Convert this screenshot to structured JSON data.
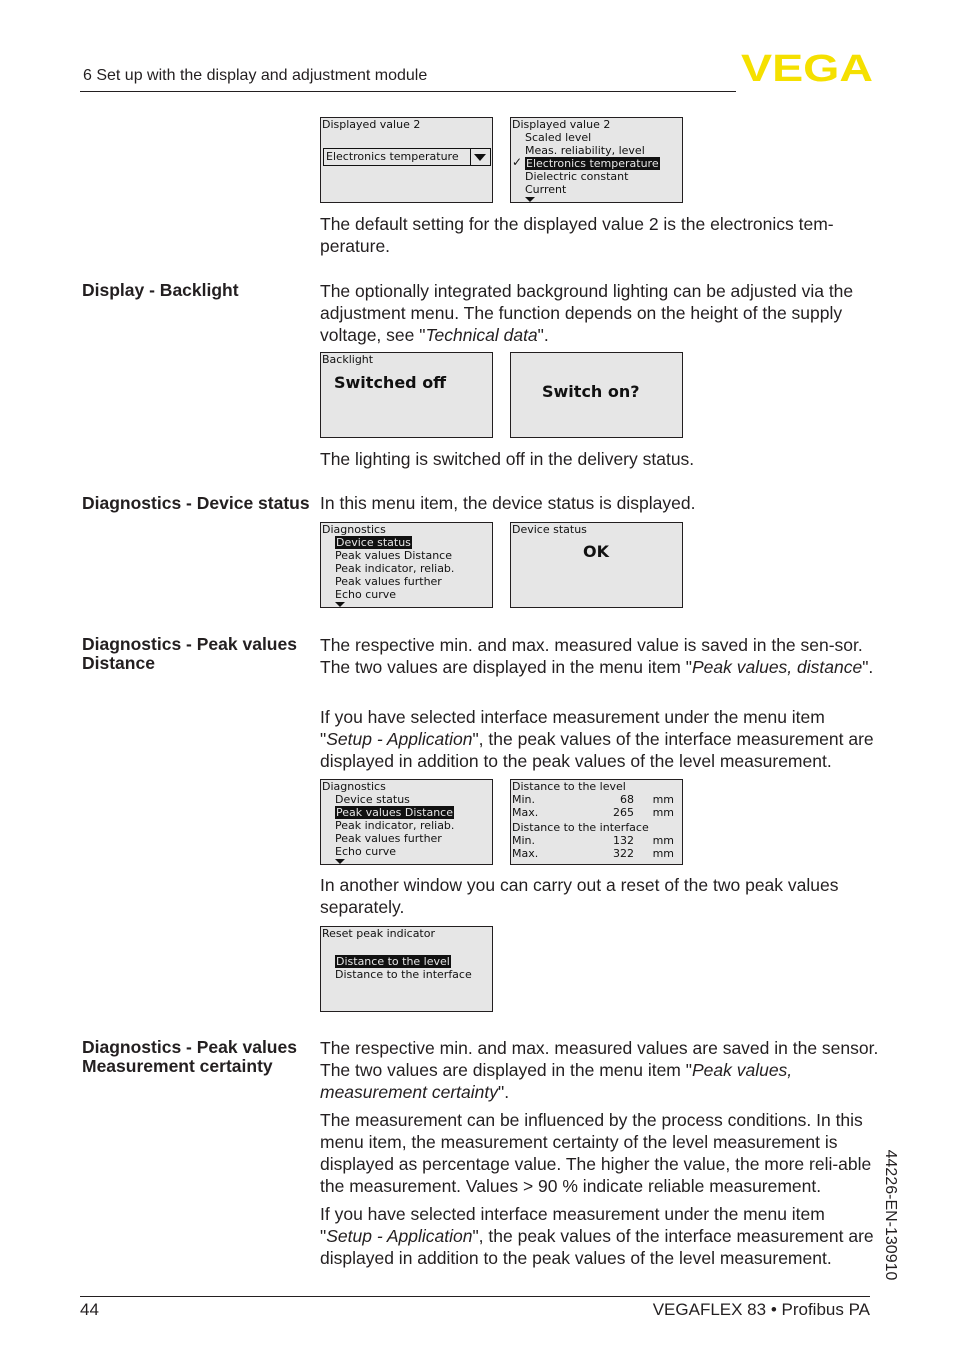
{
  "header": {
    "chapter": "6 Set up with the display and adjustment module",
    "logo_text": "VEGA",
    "logo_color": "#f5e000"
  },
  "footer": {
    "page_number": "44",
    "product": "VEGAFLEX 83 • Profibus PA",
    "doc_code": "44226-EN-130910"
  },
  "displayed_value": {
    "screen1": {
      "title": "Displayed value 2",
      "selected": "Electronics temperature"
    },
    "screen2": {
      "title": "Displayed value 2",
      "options": [
        "Scaled level",
        "Meas. reliability, level",
        "Electronics temperature",
        "Dielectric constant",
        "Current"
      ],
      "selected_index": 2
    },
    "text": "The default setting for the displayed value 2 is the electronics tem-perature."
  },
  "backlight": {
    "label": "Display - Backlight",
    "text_pre": "The optionally integrated background lighting can be adjusted via the adjustment menu. The function depends on the height of the supply voltage, see \"",
    "text_em": "Technical data",
    "text_post": "\".",
    "screen1": {
      "title": "Backlight",
      "value": "Switched off"
    },
    "screen2": {
      "value": "Switch on?"
    },
    "note": "The lighting is switched off in the delivery status."
  },
  "device_status": {
    "label": "Diagnostics - Device status",
    "text": "In this menu item, the device status is displayed.",
    "menu": {
      "title": "Diagnostics",
      "items": [
        "Device status",
        "Peak values Distance",
        "Peak indicator, reliab.",
        "Peak values further",
        "Echo curve"
      ],
      "selected_index": 0
    },
    "screen2": {
      "title": "Device status",
      "value": "OK"
    }
  },
  "peak_distance": {
    "label": "Diagnostics - Peak values Distance",
    "p1_pre": "The respective min. and max. measured value is saved in the sen-sor. The two values are displayed in the menu item \"",
    "p1_em": "Peak values, distance",
    "p1_post": "\".",
    "p2_pre": "If you have selected interface measurement under the menu item \"",
    "p2_em": "Setup - Application",
    "p2_post": "\", the peak values of the interface measurement are displayed in addition to the peak values of the level measurement.",
    "menu": {
      "title": "Diagnostics",
      "items": [
        "Device status",
        "Peak values Distance",
        "Peak indicator, reliab.",
        "Peak values further",
        "Echo curve"
      ],
      "selected_index": 1
    },
    "values": {
      "level_title": "Distance to the level",
      "level_min_label": "Min.",
      "level_min": "68",
      "level_min_unit": "mm",
      "level_max_label": "Max.",
      "level_max": "265",
      "level_max_unit": "mm",
      "interface_title": "Distance to the interface",
      "interface_min_label": "Min.",
      "interface_min": "132",
      "interface_min_unit": "mm",
      "interface_max_label": "Max.",
      "interface_max": "322",
      "interface_max_unit": "mm"
    },
    "reset_text": "In another window you can carry out a reset of the two peak values separately.",
    "reset_screen": {
      "title": "Reset peak indicator",
      "items": [
        "Distance to the level",
        "Distance to the interface"
      ],
      "selected_index": 0
    }
  },
  "peak_certainty": {
    "label": "Diagnostics - Peak values Measurement certainty",
    "p1_pre": "The respective min. and max. measured values are saved in the sensor. The two values are displayed in the menu item \"",
    "p1_em": "Peak values, measurement certainty",
    "p1_post": "\".",
    "p2": "The measurement can be influenced by the process conditions. In this menu item, the measurement certainty of the level measurement is displayed as percentage value. The higher the value, the more reli-able the measurement. Values > 90 % indicate reliable measurement.",
    "p3_pre": "If you have selected interface measurement under the menu item \"",
    "p3_em": "Setup - Application",
    "p3_post": "\", the peak values of the interface measurement are displayed in addition to the peak values of the level measurement."
  }
}
